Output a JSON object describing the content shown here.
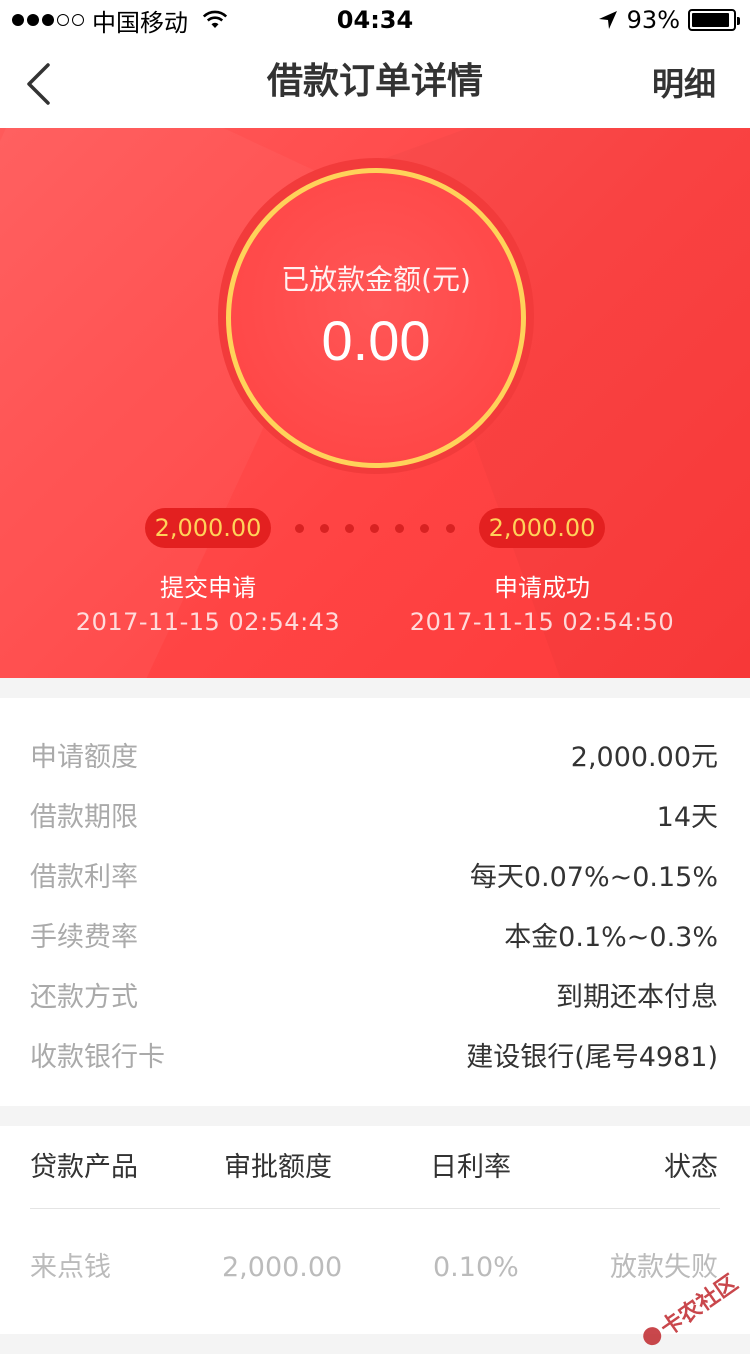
{
  "status_bar": {
    "carrier": "中国移动",
    "time": "04:34",
    "battery": "93%",
    "battery_level": 0.93,
    "signal_bars_filled": 3,
    "signal_bars_total": 5
  },
  "nav": {
    "title": "借款订单详情",
    "right_button": "明细",
    "back_icon": "chevron-left-icon"
  },
  "hero": {
    "amount_label": "已放款金额(元)",
    "amount": "0.00",
    "steps": [
      {
        "amount": "2,000.00",
        "label": "提交申请",
        "time": "2017-11-15 02:54:43"
      },
      {
        "amount": "2,000.00",
        "label": "申请成功",
        "time": "2017-11-15 02:54:50"
      }
    ],
    "colors": {
      "background": "#ff4a4a",
      "ring": "#ffd25a",
      "pill": "#e32020"
    }
  },
  "info": [
    {
      "label": "申请额度",
      "value": "2,000.00元"
    },
    {
      "label": "借款期限",
      "value": "14天"
    },
    {
      "label": "借款利率",
      "value": "每天0.07%~0.15%"
    },
    {
      "label": "手续费率",
      "value": "本金0.1%~0.3%"
    },
    {
      "label": "还款方式",
      "value": "到期还本付息"
    },
    {
      "label": "收款银行卡",
      "value": "建设银行(尾号4981)"
    }
  ],
  "table": {
    "headers": [
      "贷款产品",
      "审批额度",
      "日利率",
      "状态"
    ],
    "rows": [
      [
        "来点钱",
        "2,000.00",
        "0.10%",
        "放款失败"
      ]
    ]
  },
  "watermark": "卡农社区"
}
